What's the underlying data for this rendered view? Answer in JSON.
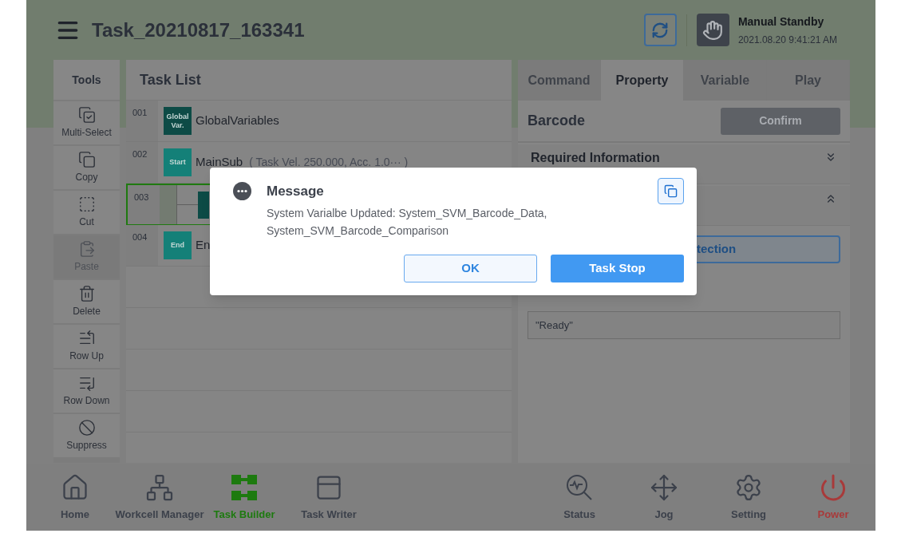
{
  "header": {
    "title": "Task_20210817_163341",
    "status_title": "Manual Standby",
    "status_time": "2021.08.20 9:41:21 AM"
  },
  "tools": {
    "title": "Tools",
    "items": [
      {
        "label": "Multi-Select",
        "disabled": false
      },
      {
        "label": "Copy",
        "disabled": false
      },
      {
        "label": "Cut",
        "disabled": false
      },
      {
        "label": "Paste",
        "disabled": true
      },
      {
        "label": "Delete",
        "disabled": false
      },
      {
        "label": "Row Up",
        "disabled": false
      },
      {
        "label": "Row Down",
        "disabled": false
      },
      {
        "label": "Suppress",
        "disabled": false
      }
    ]
  },
  "task_list": {
    "title": "Task List",
    "rows": [
      {
        "number": "001",
        "kind": "global",
        "badge": "Global Var.",
        "label": "GlobalVariables",
        "selected": false
      },
      {
        "number": "002",
        "kind": "start",
        "badge": "Start",
        "label": "MainSub",
        "detail": "( Task Vel. 250.000, Acc. 1.0··· )",
        "selected": false
      },
      {
        "number": "003",
        "kind": "node",
        "selected": true
      },
      {
        "number": "004",
        "kind": "end",
        "badge": "End",
        "label": "En",
        "selected": false
      }
    ]
  },
  "right_panel": {
    "tabs": [
      {
        "label": "Command",
        "selected": false
      },
      {
        "label": "Property",
        "selected": true
      },
      {
        "label": "Variable",
        "selected": false
      },
      {
        "label": "Play",
        "selected": false
      }
    ],
    "title": "Barcode",
    "confirm_button": {
      "label": "Confirm",
      "disabled": true
    },
    "sections": [
      {
        "label": "Required Information",
        "expanded": false
      },
      {
        "expanded": true
      }
    ],
    "action_button": "tection",
    "result_value": "\"Ready\""
  },
  "bottom_nav": [
    {
      "label": "Home",
      "selected": false,
      "kind": "nav"
    },
    {
      "label": "Workcell Manager",
      "selected": false,
      "kind": "nav"
    },
    {
      "label": "Task Builder",
      "selected": true,
      "kind": "nav"
    },
    {
      "label": "Task Writer",
      "selected": false,
      "kind": "nav"
    },
    {
      "label": "Status",
      "selected": false,
      "kind": "nav"
    },
    {
      "label": "Jog",
      "selected": false,
      "kind": "nav"
    },
    {
      "label": "Setting",
      "selected": false,
      "kind": "nav"
    },
    {
      "label": "Power",
      "selected": false,
      "kind": "power"
    }
  ],
  "dialog": {
    "title": "Message",
    "message": "System Varialbe Updated: System_SVM_Barcode_Data, System_SVM_Barcode_Comparison",
    "buttons": [
      {
        "label": "OK",
        "kind": "secondary"
      },
      {
        "label": "Task Stop",
        "kind": "primary"
      }
    ]
  }
}
